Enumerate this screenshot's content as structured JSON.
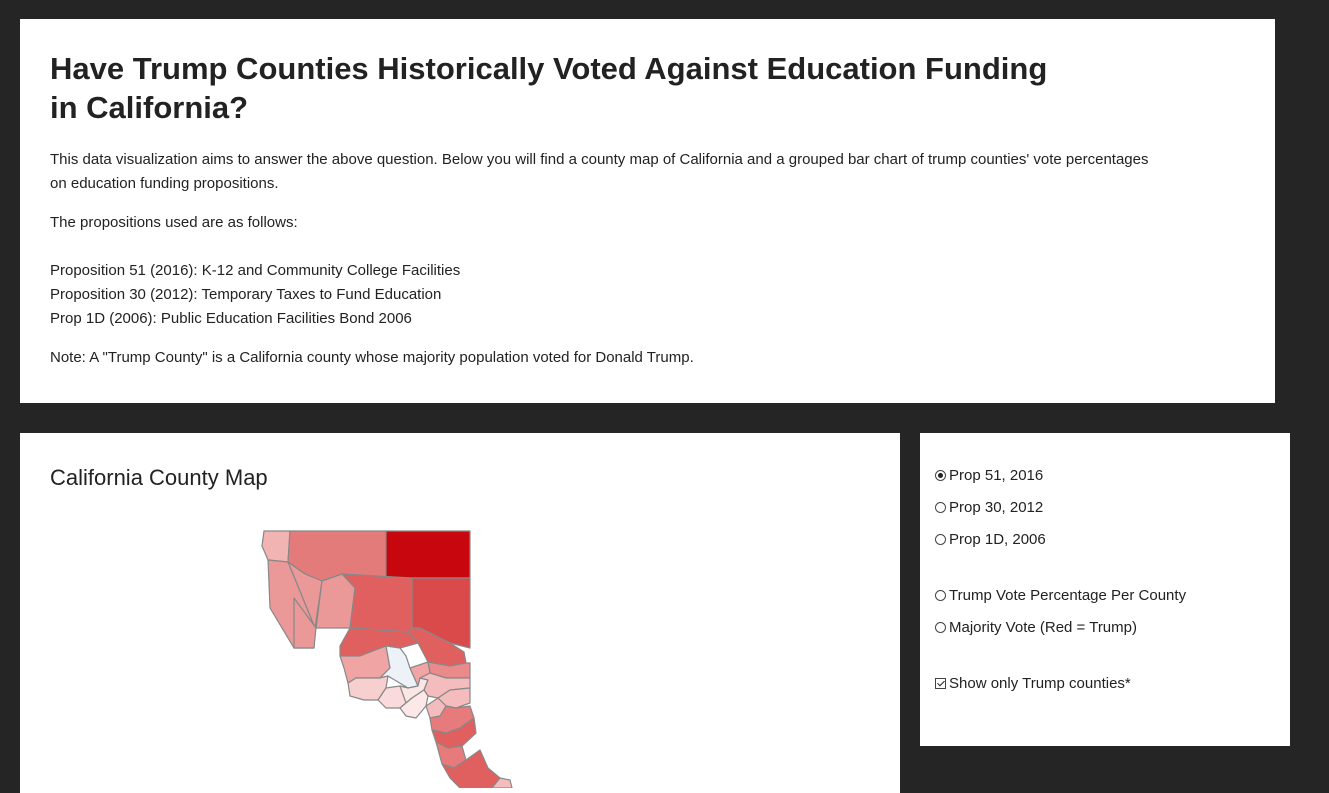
{
  "header": {
    "title": "Have Trump Counties Historically Voted Against Education Funding in California?",
    "description": "This data visualization aims to answer the above question. Below you will find a county map of California and a grouped bar chart of trump counties' vote percentages on education funding propositions.",
    "propositions_heading": "The propositions used are as follows:",
    "propositions": [
      "Proposition 51 (2016): K-12 and Community College Facilities",
      "Proposition 30 (2012): Temporary Taxes to Fund Education",
      "Prop 1D (2006): Public Education Facilities Bond 2006"
    ],
    "note": "Note: A \"Trump County\" is a California county whose majority population voted for Donald Trump."
  },
  "map": {
    "title": "California County Map",
    "colors": {
      "border": "#888888",
      "dark": "#c8060d",
      "non_trump": "#ecf2f8"
    }
  },
  "controls": {
    "proposition_options": [
      {
        "label": "Prop 51, 2016",
        "selected": true
      },
      {
        "label": "Prop 30, 2012",
        "selected": false
      },
      {
        "label": "Prop 1D, 2006",
        "selected": false
      }
    ],
    "view_options": [
      {
        "label": "Trump Vote Percentage Per County",
        "selected": false
      },
      {
        "label": "Majority Vote (Red = Trump)",
        "selected": false
      }
    ],
    "trump_only": {
      "label": "Show only Trump counties*",
      "checked": true
    }
  }
}
